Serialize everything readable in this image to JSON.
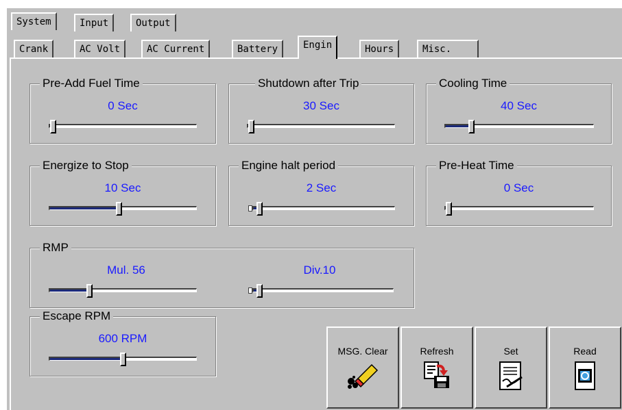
{
  "top_tabs": [
    "System",
    "Input",
    "Output"
  ],
  "sub_tabs": [
    "Crank",
    "AC Volt",
    "AC Current",
    "Battery",
    "Engin",
    "Hours",
    "Misc."
  ],
  "active_sub_tab": "Engin",
  "groups": {
    "pre_add_fuel": {
      "title": "Pre-Add Fuel Time",
      "value": "0 Sec",
      "level": 0.0
    },
    "shutdown_after_trip": {
      "title": "Shutdown after Trip",
      "value": "30 Sec",
      "level": 0.0
    },
    "cooling_time": {
      "title": "Cooling Time",
      "value": "40 Sec",
      "level": 0.16
    },
    "energize_to_stop": {
      "title": "Energize to Stop",
      "value": "10 Sec",
      "level": 0.47
    },
    "engine_halt_period": {
      "title": "Engine halt period",
      "value": "2 Sec",
      "level": 0.02
    },
    "pre_heat_time": {
      "title": "Pre-Heat Time",
      "value": "0 Sec",
      "level": 0.0
    },
    "rmp": {
      "title": "RMP",
      "mul": "Mul. 56",
      "mul_level": 0.26,
      "div": "Div.10",
      "div_level": 0.02
    },
    "escape_rpm": {
      "title": "Escape RPM",
      "value": "600 RPM",
      "level": 0.5
    }
  },
  "buttons": {
    "msg_clear": "MSG. Clear",
    "refresh": "Refresh",
    "set": "Set",
    "read": "Read"
  },
  "colors": {
    "value_text": "#1a1aff",
    "slider_fill": "#1c2a7a",
    "face": "#c0c0c0"
  }
}
